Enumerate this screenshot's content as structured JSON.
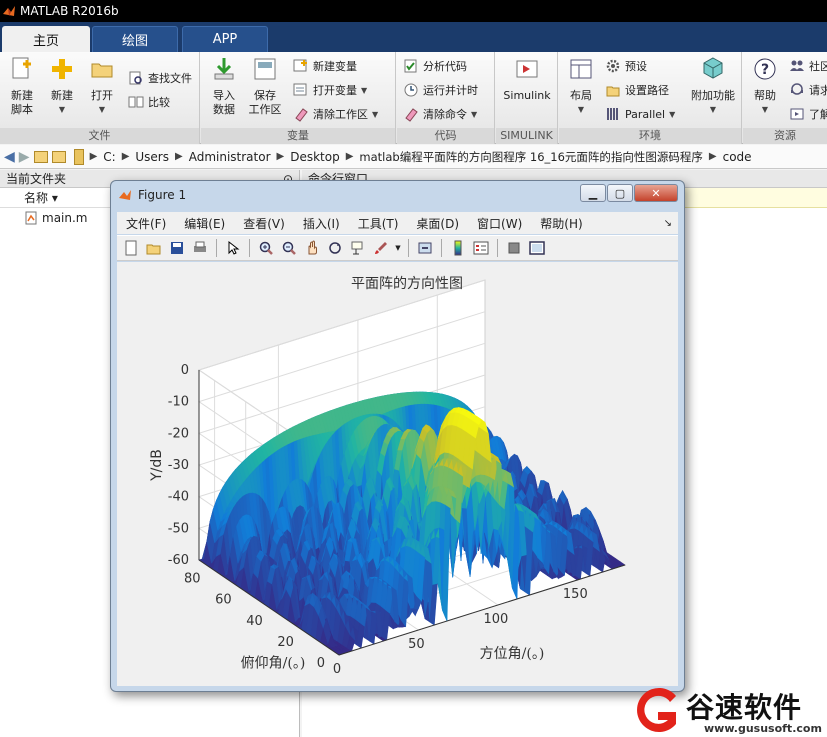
{
  "app": {
    "title": "MATLAB R2016b"
  },
  "tabs": [
    {
      "label": "主页",
      "active": true
    },
    {
      "label": "绘图",
      "active": false
    },
    {
      "label": "APP",
      "active": false
    }
  ],
  "toolstrip": {
    "file": {
      "label": "文件",
      "new_script": "新建\n脚本",
      "new": "新建",
      "open": "打开",
      "find_files": "查找文件",
      "compare": "比较"
    },
    "variable": {
      "label": "变量",
      "import": "导入\n数据",
      "save": "保存\n工作区",
      "new_var": "新建变量",
      "open_var": "打开变量",
      "clear_ws": "清除工作区"
    },
    "code": {
      "label": "代码",
      "analyze": "分析代码",
      "run_time": "运行并计时",
      "clear_cmd": "清除命令"
    },
    "simulink": {
      "label": "SIMULINK",
      "simulink": "Simulink"
    },
    "env": {
      "label": "环境",
      "layout": "布局",
      "prefs": "预设",
      "set_path": "设置路径",
      "parallel": "Parallel",
      "addons": "附加功能"
    },
    "resources": {
      "label": "资源",
      "help": "帮助",
      "community": "社区",
      "request": "请求",
      "learn": "了解"
    }
  },
  "address": {
    "crumbs": [
      "C:",
      "Users",
      "Administrator",
      "Desktop",
      "matlab编程平面阵的方向图程序 16_16元面阵的指向性图源码程序",
      "code"
    ]
  },
  "file_panel": {
    "title": "当前文件夹",
    "col_name": "名称 ▾",
    "files": [
      "main.m"
    ]
  },
  "cmd_panel": {
    "title": "命令行窗口"
  },
  "figure": {
    "title": "Figure 1",
    "menu": [
      "文件(F)",
      "编辑(E)",
      "查看(V)",
      "插入(I)",
      "工具(T)",
      "桌面(D)",
      "窗口(W)",
      "帮助(H)"
    ],
    "tool_icons": [
      "new-figure-icon",
      "open-icon",
      "save-icon",
      "print-icon",
      "pointer-icon",
      "zoom-in-icon",
      "zoom-out-icon",
      "pan-icon",
      "rotate-icon",
      "data-cursor-icon",
      "brush-icon",
      "link-icon",
      "colorbar-icon",
      "legend-icon",
      "hide-plot-tools-icon",
      "show-plot-tools-icon"
    ]
  },
  "chart_data": {
    "type": "surface",
    "title": "平面阵的方向性图",
    "xlabel": "方位角/(。)",
    "ylabel": "俯仰角/(。)",
    "zlabel": "Y/dB",
    "xlim": [
      0,
      180
    ],
    "ylim": [
      0,
      90
    ],
    "zlim": [
      -60,
      0
    ],
    "xticks": [
      0,
      50,
      100,
      150
    ],
    "yticks": [
      0,
      20,
      40,
      60,
      80
    ],
    "zticks": [
      0,
      -10,
      -20,
      -30,
      -40,
      -50,
      -60
    ],
    "colormap": "parula",
    "colors": {
      "low": "#352a87",
      "mid": "#21b5a2",
      "high": "#f9fb0e"
    }
  },
  "watermark": {
    "text": "谷速软件",
    "url": "www.gususoft.com"
  }
}
